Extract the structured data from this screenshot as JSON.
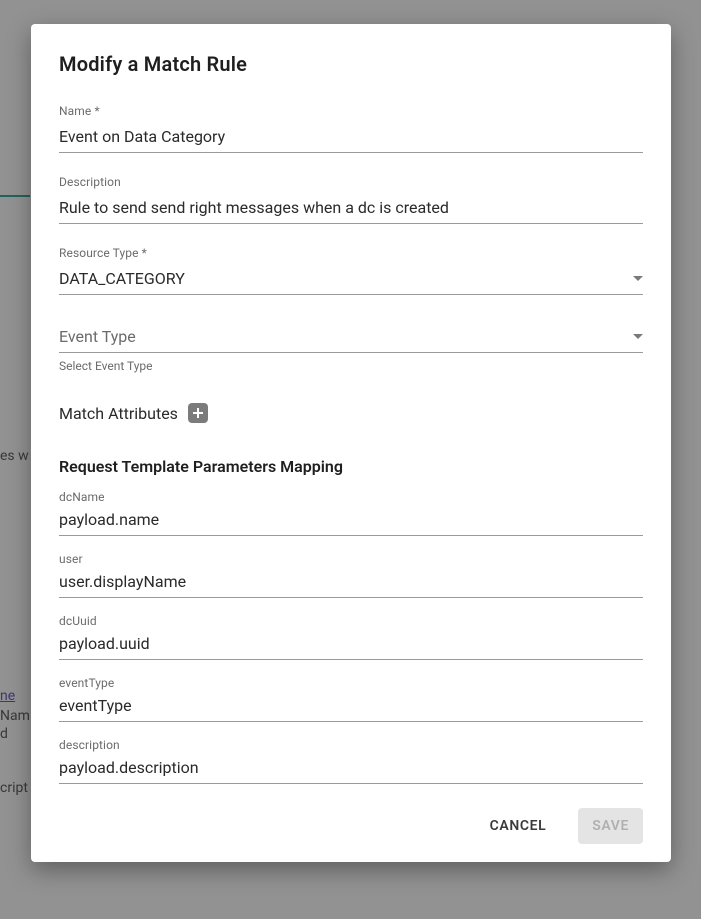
{
  "dialog": {
    "title": "Modify a Match Rule"
  },
  "fields": {
    "name": {
      "label": "Name *",
      "value": "Event on Data Category"
    },
    "description": {
      "label": "Description",
      "value": "Rule to send send right messages when a dc is created"
    },
    "resourceType": {
      "label": "Resource Type *",
      "value": "DATA_CATEGORY"
    },
    "eventType": {
      "placeholder": "Event Type",
      "helper": "Select Event Type"
    }
  },
  "matchAttributes": {
    "label": "Match Attributes"
  },
  "paramsSection": {
    "title": "Request Template Parameters Mapping",
    "items": [
      {
        "label": "dcName",
        "value": "payload.name"
      },
      {
        "label": "user",
        "value": "user.displayName"
      },
      {
        "label": "dcUuid",
        "value": "payload.uuid"
      },
      {
        "label": "eventType",
        "value": "eventType"
      },
      {
        "label": "description",
        "value": "payload.description"
      }
    ]
  },
  "actions": {
    "cancel": "CANCEL",
    "save": "SAVE"
  },
  "background": {
    "frag1": "es w",
    "link": "ne",
    "frag2": "Nam",
    "frag3": "d",
    "frag4": "cript"
  }
}
